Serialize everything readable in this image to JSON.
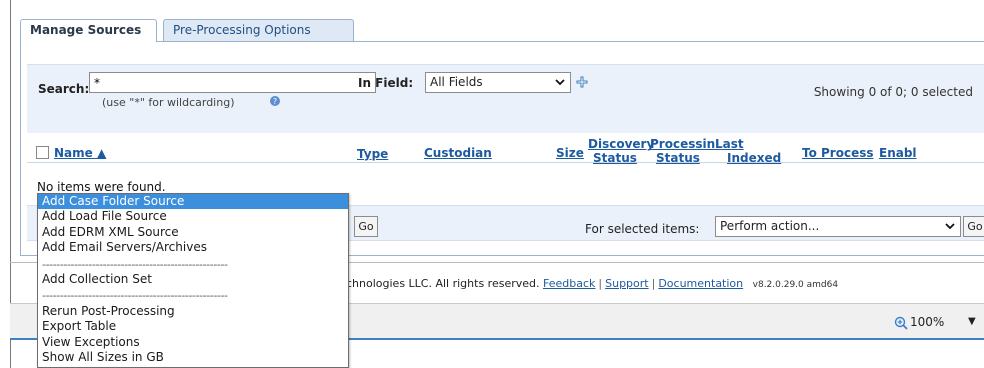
{
  "tabs": [
    {
      "label": "Manage Sources",
      "active": true
    },
    {
      "label": "Pre-Processing Options",
      "active": false
    }
  ],
  "search": {
    "label": "Search:",
    "value": "*",
    "hint": "(use \"*\" for wildcarding)",
    "field_label": "In Field:",
    "field_value": "All Fields",
    "showing": "Showing 0 of 0; 0 selected"
  },
  "table": {
    "columns": [
      {
        "label": "Name ▲"
      },
      {
        "label": "Type"
      },
      {
        "label": "Custodian"
      },
      {
        "label": "Size"
      },
      {
        "label": "Discovery",
        "sub": "Status"
      },
      {
        "label": "Processin",
        "sub": "Status"
      },
      {
        "label": "Last",
        "sub": "Indexed"
      },
      {
        "label": "To Process"
      },
      {
        "label": "Enabl"
      }
    ],
    "empty_message": "No items were found."
  },
  "bottom": {
    "go_label": "Go",
    "for_selected_label": "For selected items:",
    "action_value": "Perform action...",
    "go2_label": "Go"
  },
  "footer": {
    "copyright": "chnologies LLC. All rights reserved.",
    "links": [
      "Feedback",
      "Support",
      "Documentation"
    ],
    "version": "v8.2.0.29.0 amd64"
  },
  "statusbar": {
    "zoom": "100%"
  },
  "menu": {
    "items": [
      {
        "label": "Add Case Folder Source",
        "highlighted": true
      },
      {
        "label": "Add Load File Source"
      },
      {
        "label": "Add EDRM XML Source"
      },
      {
        "label": "Add Email Servers/Archives"
      },
      {
        "separator": "----------------------------------------------------"
      },
      {
        "label": "Add Collection Set"
      },
      {
        "separator": "----------------------------------------------------"
      },
      {
        "label": "Rerun Post-Processing"
      },
      {
        "label": "Export Table"
      },
      {
        "label": "View Exceptions"
      },
      {
        "label": "Show All Sizes in GB"
      }
    ]
  },
  "colors": {
    "link": "#1e5aa0",
    "band": "#eaf1fa",
    "highlight": "#3c8fdc"
  }
}
